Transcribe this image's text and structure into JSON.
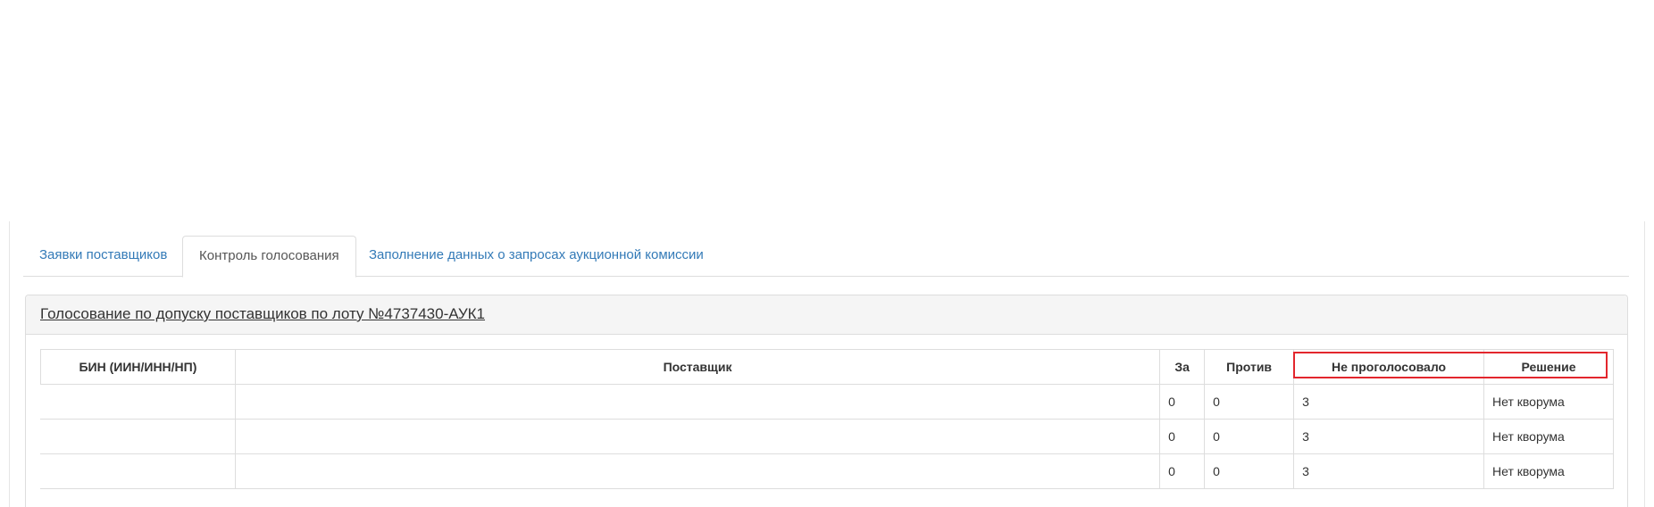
{
  "tabs": [
    {
      "label": "Заявки поставщиков",
      "active": false
    },
    {
      "label": "Контроль голосования",
      "active": true
    },
    {
      "label": "Заполнение данных о запросах аукционной комиссии",
      "active": false
    }
  ],
  "voting": {
    "title": "Голосование по допуску поставщиков по лоту №4737430-АУК1",
    "columns": [
      "БИН (ИИН/ИНН/НП)",
      "Поставщик",
      "За",
      "Против",
      "Не проголосовало",
      "Решение"
    ],
    "rows": [
      {
        "bin": "",
        "supplier": "",
        "for": "0",
        "against": "0",
        "not_voted": "3",
        "decision": "Нет кворума"
      },
      {
        "bin": "",
        "supplier": "",
        "for": "0",
        "against": "0",
        "not_voted": "3",
        "decision": "Нет кворума"
      },
      {
        "bin": "",
        "supplier": "",
        "for": "0",
        "against": "0",
        "not_voted": "3",
        "decision": "Нет кворума"
      }
    ]
  },
  "colors": {
    "link": "#337ab7",
    "highlight": "#e3262d",
    "heading_bg": "#f5f5f5",
    "border": "#dddddd"
  }
}
